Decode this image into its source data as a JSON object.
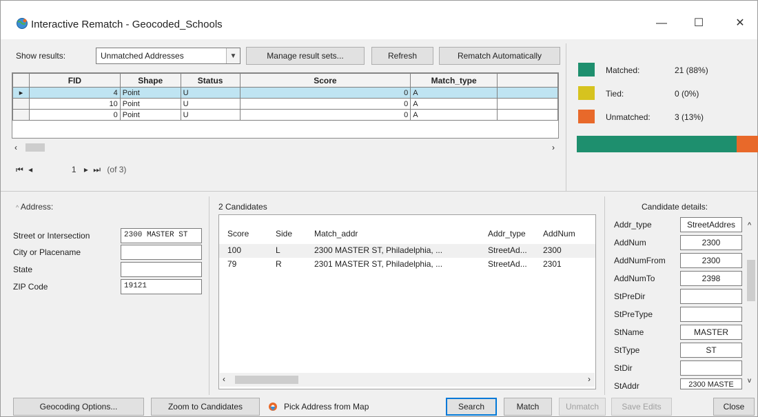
{
  "window": {
    "title": "Interactive Rematch - Geocoded_Schools",
    "controls": {
      "minimize": "—",
      "maximize": "☐",
      "close": "✕"
    }
  },
  "toolbar": {
    "show_results_label": "Show results:",
    "show_results_value": "Unmatched Addresses",
    "manage_label": "Manage result sets...",
    "refresh_label": "Refresh",
    "rematch_auto_label": "Rematch Automatically"
  },
  "grid": {
    "columns": [
      "FID",
      "Shape",
      "Status",
      "Score",
      "Match_type"
    ],
    "rows": [
      {
        "fid": "4",
        "shape": "Point",
        "status": "U",
        "score": "0",
        "match_type": "A",
        "selected": true
      },
      {
        "fid": "10",
        "shape": "Point",
        "status": "U",
        "score": "0",
        "match_type": "A",
        "selected": false
      },
      {
        "fid": "0",
        "shape": "Point",
        "status": "U",
        "score": "0",
        "match_type": "A",
        "selected": false
      }
    ]
  },
  "pager": {
    "first": "⏮",
    "prev": "◂",
    "page": "1",
    "next": "▸",
    "last": "⏭",
    "total": "(of 3)"
  },
  "stats": {
    "matched_label": "Matched:",
    "matched_value": "21 (88%)",
    "matched_color": "#1e8f6e",
    "tied_label": "Tied:",
    "tied_value": "0 (0%)",
    "tied_color": "#d6c31f",
    "unmatched_label": "Unmatched:",
    "unmatched_value": "3 (13%)",
    "unmatched_color": "#e8692a",
    "matched_fraction": 0.88
  },
  "address": {
    "title": "Address:",
    "street_label": "Street or Intersection",
    "street_value": "2300 MASTER ST",
    "city_label": "City or Placename",
    "city_value": "",
    "state_label": "State",
    "state_value": "",
    "zip_label": "ZIP Code",
    "zip_value": "19121"
  },
  "candidates": {
    "title": "2 Candidates",
    "columns": [
      "Score",
      "Side",
      "Match_addr",
      "Addr_type",
      "AddNum"
    ],
    "rows": [
      {
        "score": "100",
        "side": "L",
        "match_addr": "2300 MASTER ST, Philadelphia, ...",
        "addr_type": "StreetAd...",
        "addnum": "2300"
      },
      {
        "score": "79",
        "side": "R",
        "match_addr": "2301 MASTER ST, Philadelphia, ...",
        "addr_type": "StreetAd...",
        "addnum": "2301"
      }
    ]
  },
  "details": {
    "title": "Candidate details:",
    "fields": [
      {
        "label": "Addr_type",
        "value": "StreetAddres"
      },
      {
        "label": "AddNum",
        "value": "2300"
      },
      {
        "label": "AddNumFrom",
        "value": "2300"
      },
      {
        "label": "AddNumTo",
        "value": "2398"
      },
      {
        "label": "StPreDir",
        "value": ""
      },
      {
        "label": "StPreType",
        "value": ""
      },
      {
        "label": "StName",
        "value": "MASTER"
      },
      {
        "label": "StType",
        "value": "ST"
      },
      {
        "label": "StDir",
        "value": ""
      },
      {
        "label": "StAddr",
        "value": "2300 MASTE"
      }
    ]
  },
  "footer": {
    "geocoding_options": "Geocoding Options...",
    "zoom_to_candidates": "Zoom to Candidates",
    "pick_address": "Pick Address from Map",
    "search": "Search",
    "match": "Match",
    "unmatch": "Unmatch",
    "save_edits": "Save Edits",
    "close": "Close"
  }
}
